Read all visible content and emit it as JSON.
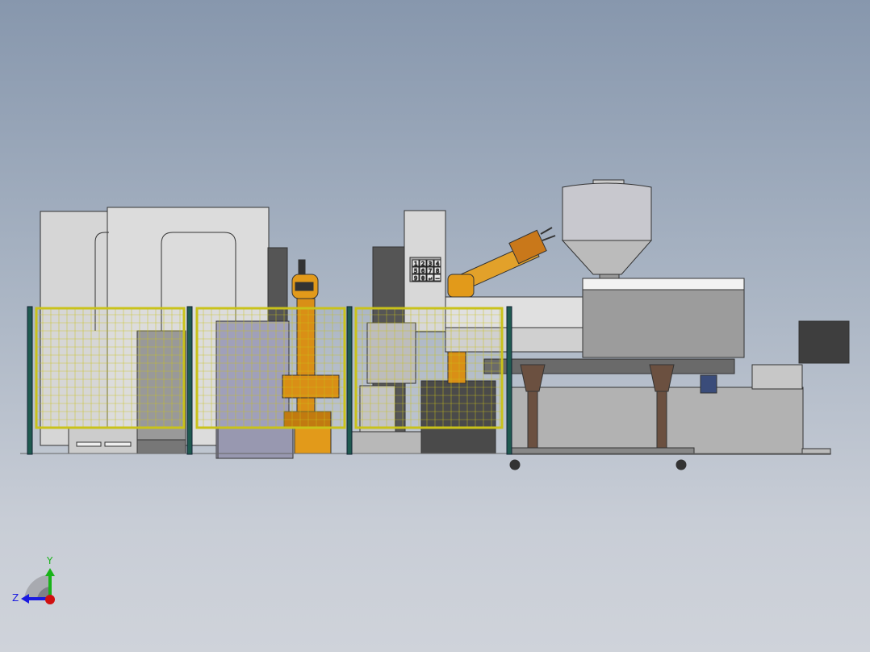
{
  "viewport": {
    "background_top": "#8797ad",
    "background_bottom": "#cfd3da"
  },
  "model": {
    "fence_frame_color": "#c9c21a",
    "fence_post_color": "#1f5a50",
    "robot_color": "#e29a1a",
    "control_panel": {
      "keypad_keys": [
        "1",
        "2",
        "3",
        "4",
        "5",
        "6",
        "7",
        "8",
        "9",
        "0",
        "↵",
        "–"
      ]
    }
  },
  "triad": {
    "y_label": "Y",
    "z_label": "Z",
    "y_color": "#19b319",
    "z_color": "#1a1ae0",
    "x_color": "#d01010"
  }
}
